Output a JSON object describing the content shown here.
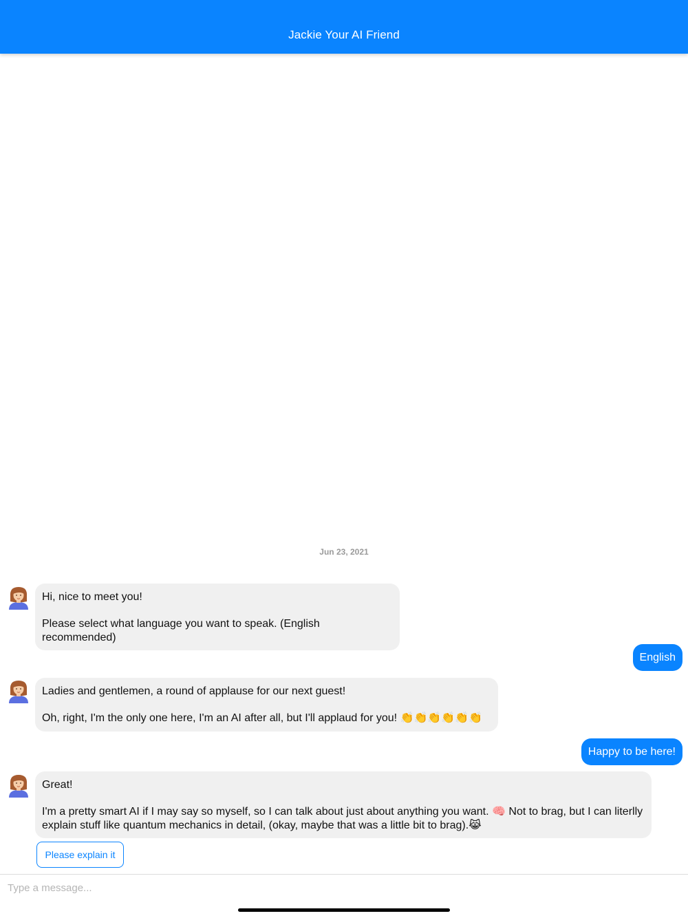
{
  "header": {
    "title": "Jackie Your AI Friend"
  },
  "conversation": {
    "date": "Jun 23, 2021",
    "messages": [
      {
        "from": "bot",
        "paragraphs": [
          "Hi, nice to meet you!",
          "Please select what language you want to speak. (English recommended)"
        ]
      },
      {
        "from": "user",
        "text": "English"
      },
      {
        "from": "bot",
        "paragraphs": [
          "Ladies and gentlemen, a round of applause for our next guest!",
          "Oh, right, I'm the only one here, I'm an AI after all, but I'll applaud for you! 👏👏👏👏👏👏"
        ]
      },
      {
        "from": "user",
        "text": "Happy to be here!"
      },
      {
        "from": "bot",
        "paragraphs": [
          "Great!",
          "I'm a pretty smart AI if I may say so myself, so I can talk about just about anything you want. 🧠 Not to brag, but I can literlly explain stuff like quantum mechanics in detail, (okay, maybe that was a little bit to brag).😹"
        ]
      }
    ],
    "quick_replies": [
      "Please explain it"
    ]
  },
  "composer": {
    "placeholder": "Type a message..."
  },
  "colors": {
    "accent": "#0a84ff",
    "bot_bubble": "#f0f0f0",
    "date_text": "#9a9a9a"
  },
  "icons": {
    "avatar": "avatar-icon"
  }
}
